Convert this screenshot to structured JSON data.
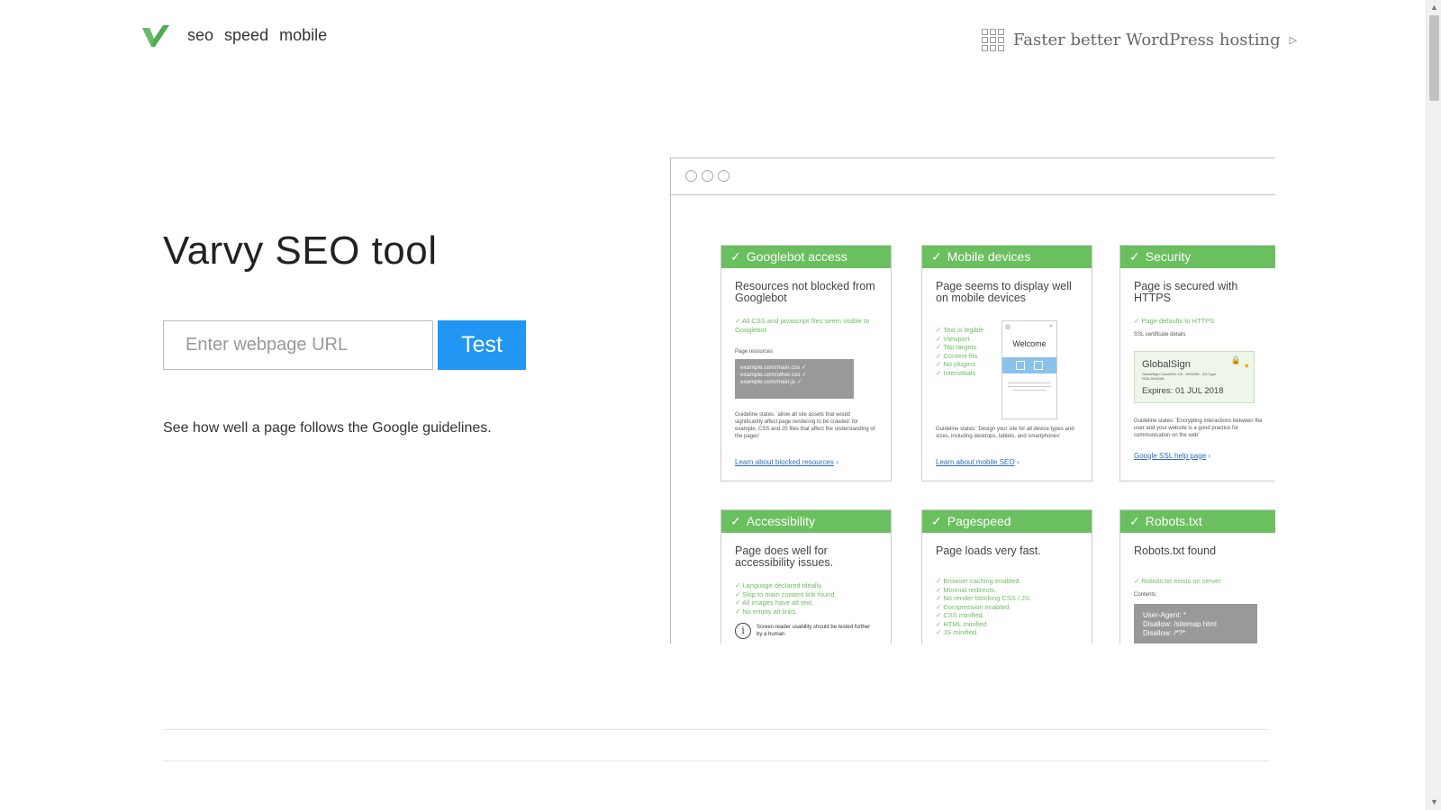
{
  "header": {
    "logo_icon": "varvy-check-logo-icon",
    "nav": [
      "seo",
      "speed",
      "mobile"
    ],
    "promo_icon": "grid-icon",
    "promo_text": "Faster better WordPress hosting",
    "promo_arrow": "▷"
  },
  "hero": {
    "title": "Varvy SEO tool",
    "url_placeholder": "Enter webpage URL",
    "test_label": "Test",
    "tagline": "See how well a page follows the Google guidelines."
  },
  "colors": {
    "accent_green": "#6abf5e",
    "button_blue": "#2196f3",
    "link_blue": "#2a6ebb"
  },
  "cards": {
    "googlebot": {
      "head": "Googlebot access",
      "title": "Resources not blocked from Googlebot",
      "check": "All CSS and javascript files seem visible to Googlebot",
      "res_label": "Page resources",
      "resources": [
        "example.com/main.css ✓",
        "example.com/other.css ✓",
        "example.com/main.js ✓"
      ],
      "guideline": "Guideline states: 'allow all site assets that would significantly affect page rendering to be crawled: for example, CSS and JS files that affect the understanding of the pages'",
      "link": "Learn about blocked resources"
    },
    "mobile": {
      "head": "Mobile devices",
      "title": "Page seems to display well on mobile devices",
      "checks": [
        "Text is legible",
        "Viewport",
        "Tap targets",
        "Content fits",
        "No plugins",
        "Interstitials"
      ],
      "phone_welcome": "Welcome",
      "guideline": "Guideline states: 'Design your site for all device types and sizes, including desktops, tablets, and smartphones'",
      "link": "Learn about mobile SEO"
    },
    "security": {
      "head": "Security",
      "title": "Page is secured with HTTPS",
      "check": "Page defaults to HTTPS",
      "ssl_label": "SSL certificate details",
      "ssl_name": "GlobalSign",
      "ssl_small": "GlobalSign CloudSSL CA - SHA256 - G3 Type: RSA-SHA256",
      "ssl_expires": "Expires: 01 JUL 2018",
      "guideline": "Guideline states: 'Encrypting interactions between the user and your website is a good practice for communication on the web'",
      "link": "Google SSL help page"
    },
    "accessibility": {
      "head": "Accessibility",
      "title": "Page does well for accessibility issues.",
      "checks": [
        "Language declared ideally.",
        "Skip to main content link found.",
        "All images have alt text.",
        "No empty alt links."
      ],
      "note": "Screen reader usability should be tested further by a human."
    },
    "pagespeed": {
      "head": "Pagespeed",
      "title": "Page loads very fast.",
      "checks": [
        "Browser caching enabled.",
        "Minimal redirects.",
        "No render blocking CSS / JS.",
        "Compression enabled.",
        "CSS minified.",
        "HTML minified.",
        "JS minified."
      ]
    },
    "robots": {
      "head": "Robots.txt",
      "title": "Robots.txt found",
      "check": "Robots.txt exists on server",
      "contents_label": "Contents:",
      "lines": [
        "User-Agent: *",
        "Disallow: /sitemap.html",
        "Disallow: /*?*"
      ]
    }
  }
}
